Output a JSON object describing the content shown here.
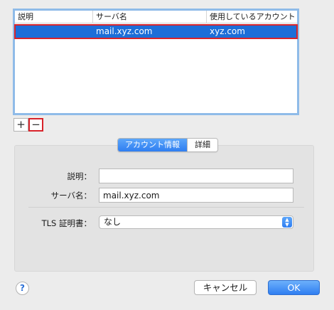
{
  "table": {
    "columns": [
      "説明",
      "サーバ名",
      "使用しているアカウント"
    ],
    "rows": [
      {
        "description": "",
        "server": "mail.xyz.com",
        "account": "xyz.com",
        "selected": true
      }
    ]
  },
  "list_buttons": {
    "add": "+",
    "remove": "−"
  },
  "tabs": [
    {
      "label": "アカウント情報",
      "active": true
    },
    {
      "label": "詳細",
      "active": false
    }
  ],
  "form": {
    "description_label": "説明：",
    "description_value": "",
    "server_label": "サーバ名：",
    "server_value": "mail.xyz.com",
    "tls_label": "TLS 証明書：",
    "tls_value": "なし"
  },
  "footer": {
    "help": "?",
    "cancel": "キャンセル",
    "ok": "OK"
  },
  "colors": {
    "accent": "#2f7ef1",
    "selection": "#1d6ed8",
    "highlight_box": "#d8232a"
  }
}
